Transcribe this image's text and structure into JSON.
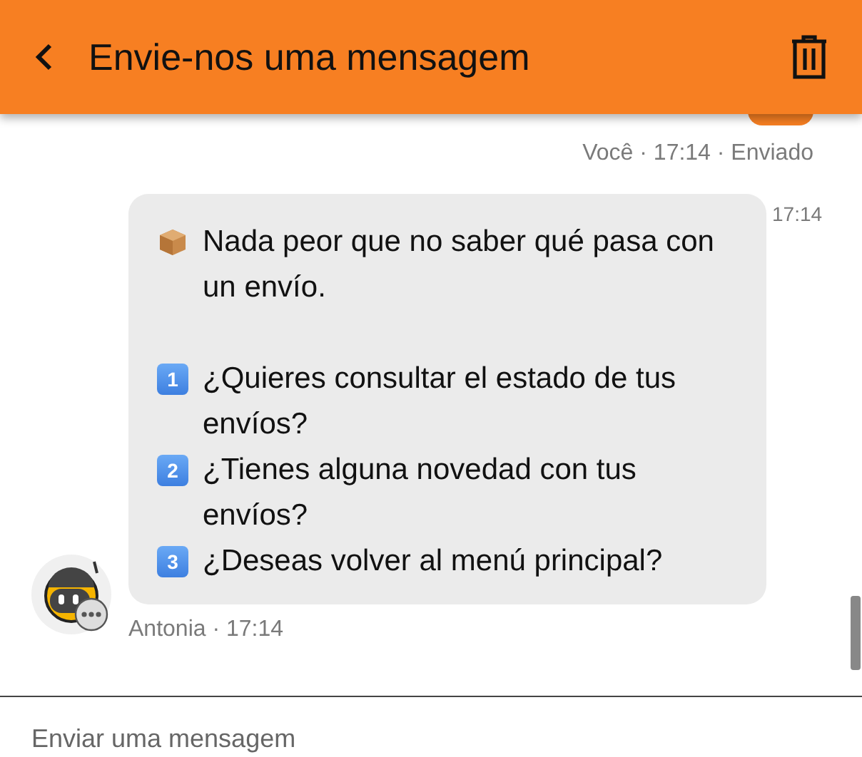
{
  "header": {
    "title": "Envie-nos uma mensagem"
  },
  "sent_message": {
    "meta": "Você · 17:14 · Enviado"
  },
  "bot_message": {
    "time": "17:14",
    "lines": [
      {
        "kind": "box",
        "text": "Nada peor que no saber qué pasa con un envío."
      },
      {
        "kind": "gap"
      },
      {
        "kind": "key",
        "key": "1",
        "text": "¿Quieres consultar el estado de tus envíos?"
      },
      {
        "kind": "key",
        "key": "2",
        "text": "¿Tienes alguna novedad con tus envíos?"
      },
      {
        "kind": "key",
        "key": "3",
        "text": "¿Deseas volver al menú principal?"
      }
    ],
    "meta": "Antonia · 17:14"
  },
  "composer": {
    "placeholder": "Enviar uma mensagem"
  }
}
